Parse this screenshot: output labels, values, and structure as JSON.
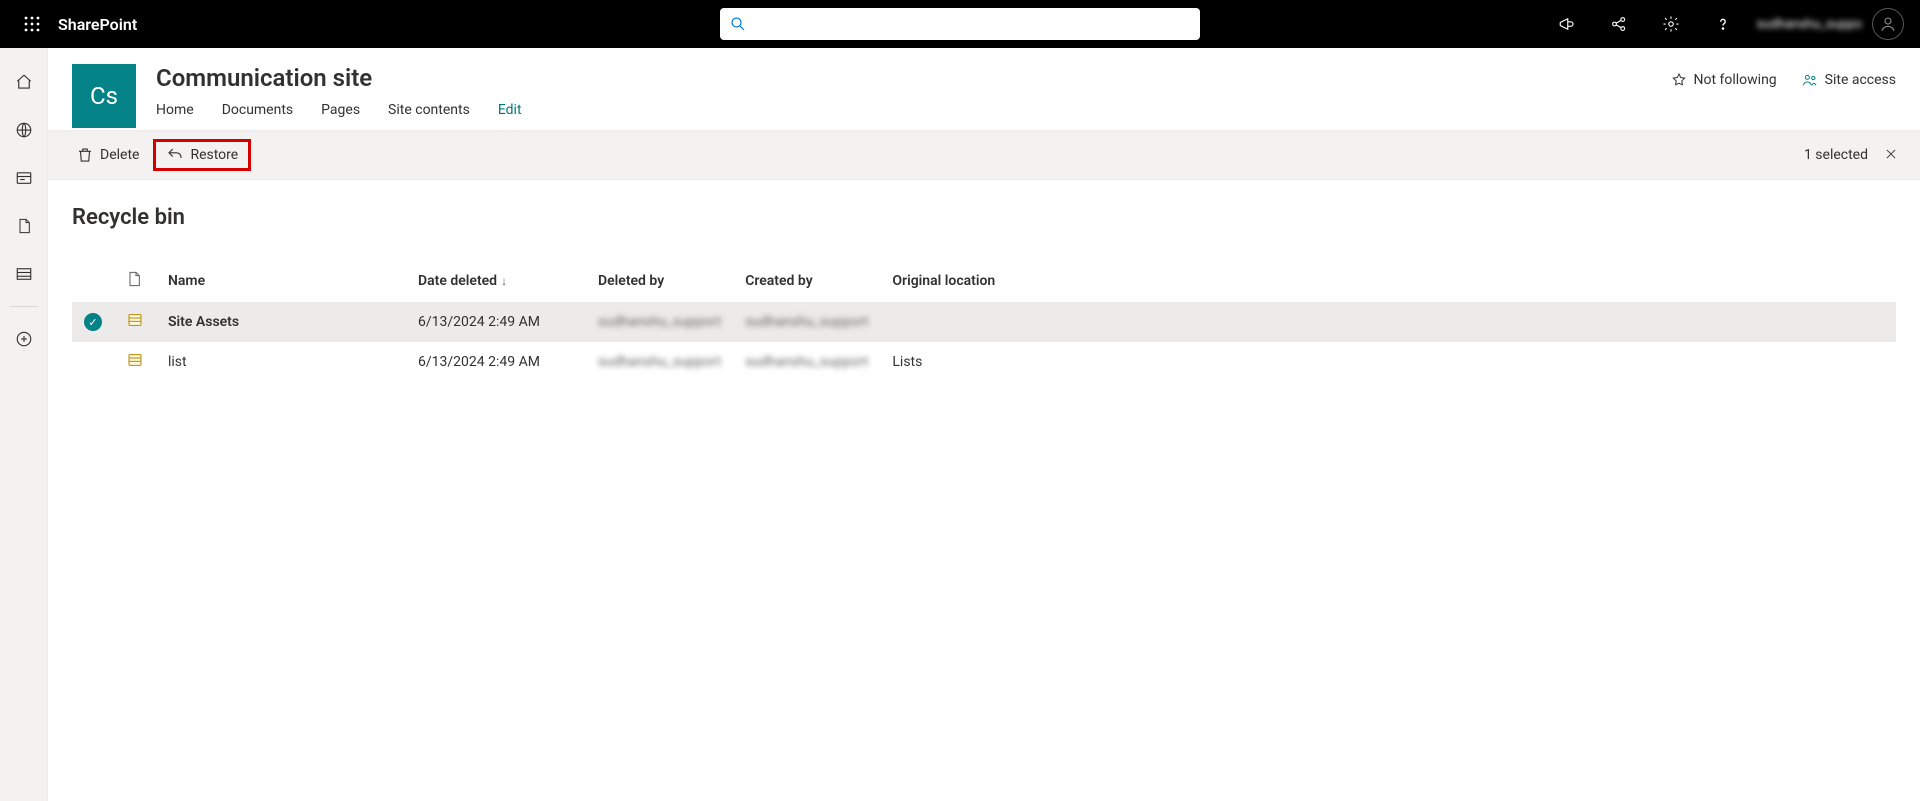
{
  "topbar": {
    "brand": "SharePoint",
    "search_placeholder": "",
    "user_name": "sudhanshu_suppo"
  },
  "leftrail": {
    "items": [
      "home",
      "globe",
      "news",
      "file",
      "list",
      "add"
    ]
  },
  "site": {
    "logo_text": "Cs",
    "title": "Communication site",
    "nav": {
      "home": "Home",
      "documents": "Documents",
      "pages": "Pages",
      "site_contents": "Site contents",
      "edit": "Edit"
    },
    "actions": {
      "not_following": "Not following",
      "site_access": "Site access"
    }
  },
  "cmdbar": {
    "delete": "Delete",
    "restore": "Restore",
    "selected_text": "1 selected"
  },
  "page": {
    "title": "Recycle bin"
  },
  "table": {
    "headers": {
      "name": "Name",
      "date_deleted": "Date deleted",
      "deleted_by": "Deleted by",
      "created_by": "Created by",
      "original_location": "Original location"
    },
    "sort_indicator": "↓",
    "rows": [
      {
        "selected": true,
        "icon": "list-icon",
        "name": "Site Assets",
        "date_deleted": "6/13/2024 2:49 AM",
        "deleted_by": "sudhanshu_support",
        "created_by": "sudhanshu_support",
        "original_location": ""
      },
      {
        "selected": false,
        "icon": "list-icon",
        "name": "list",
        "date_deleted": "6/13/2024 2:49 AM",
        "deleted_by": "sudhanshu_support",
        "created_by": "sudhanshu_support",
        "original_location": "Lists"
      }
    ]
  }
}
